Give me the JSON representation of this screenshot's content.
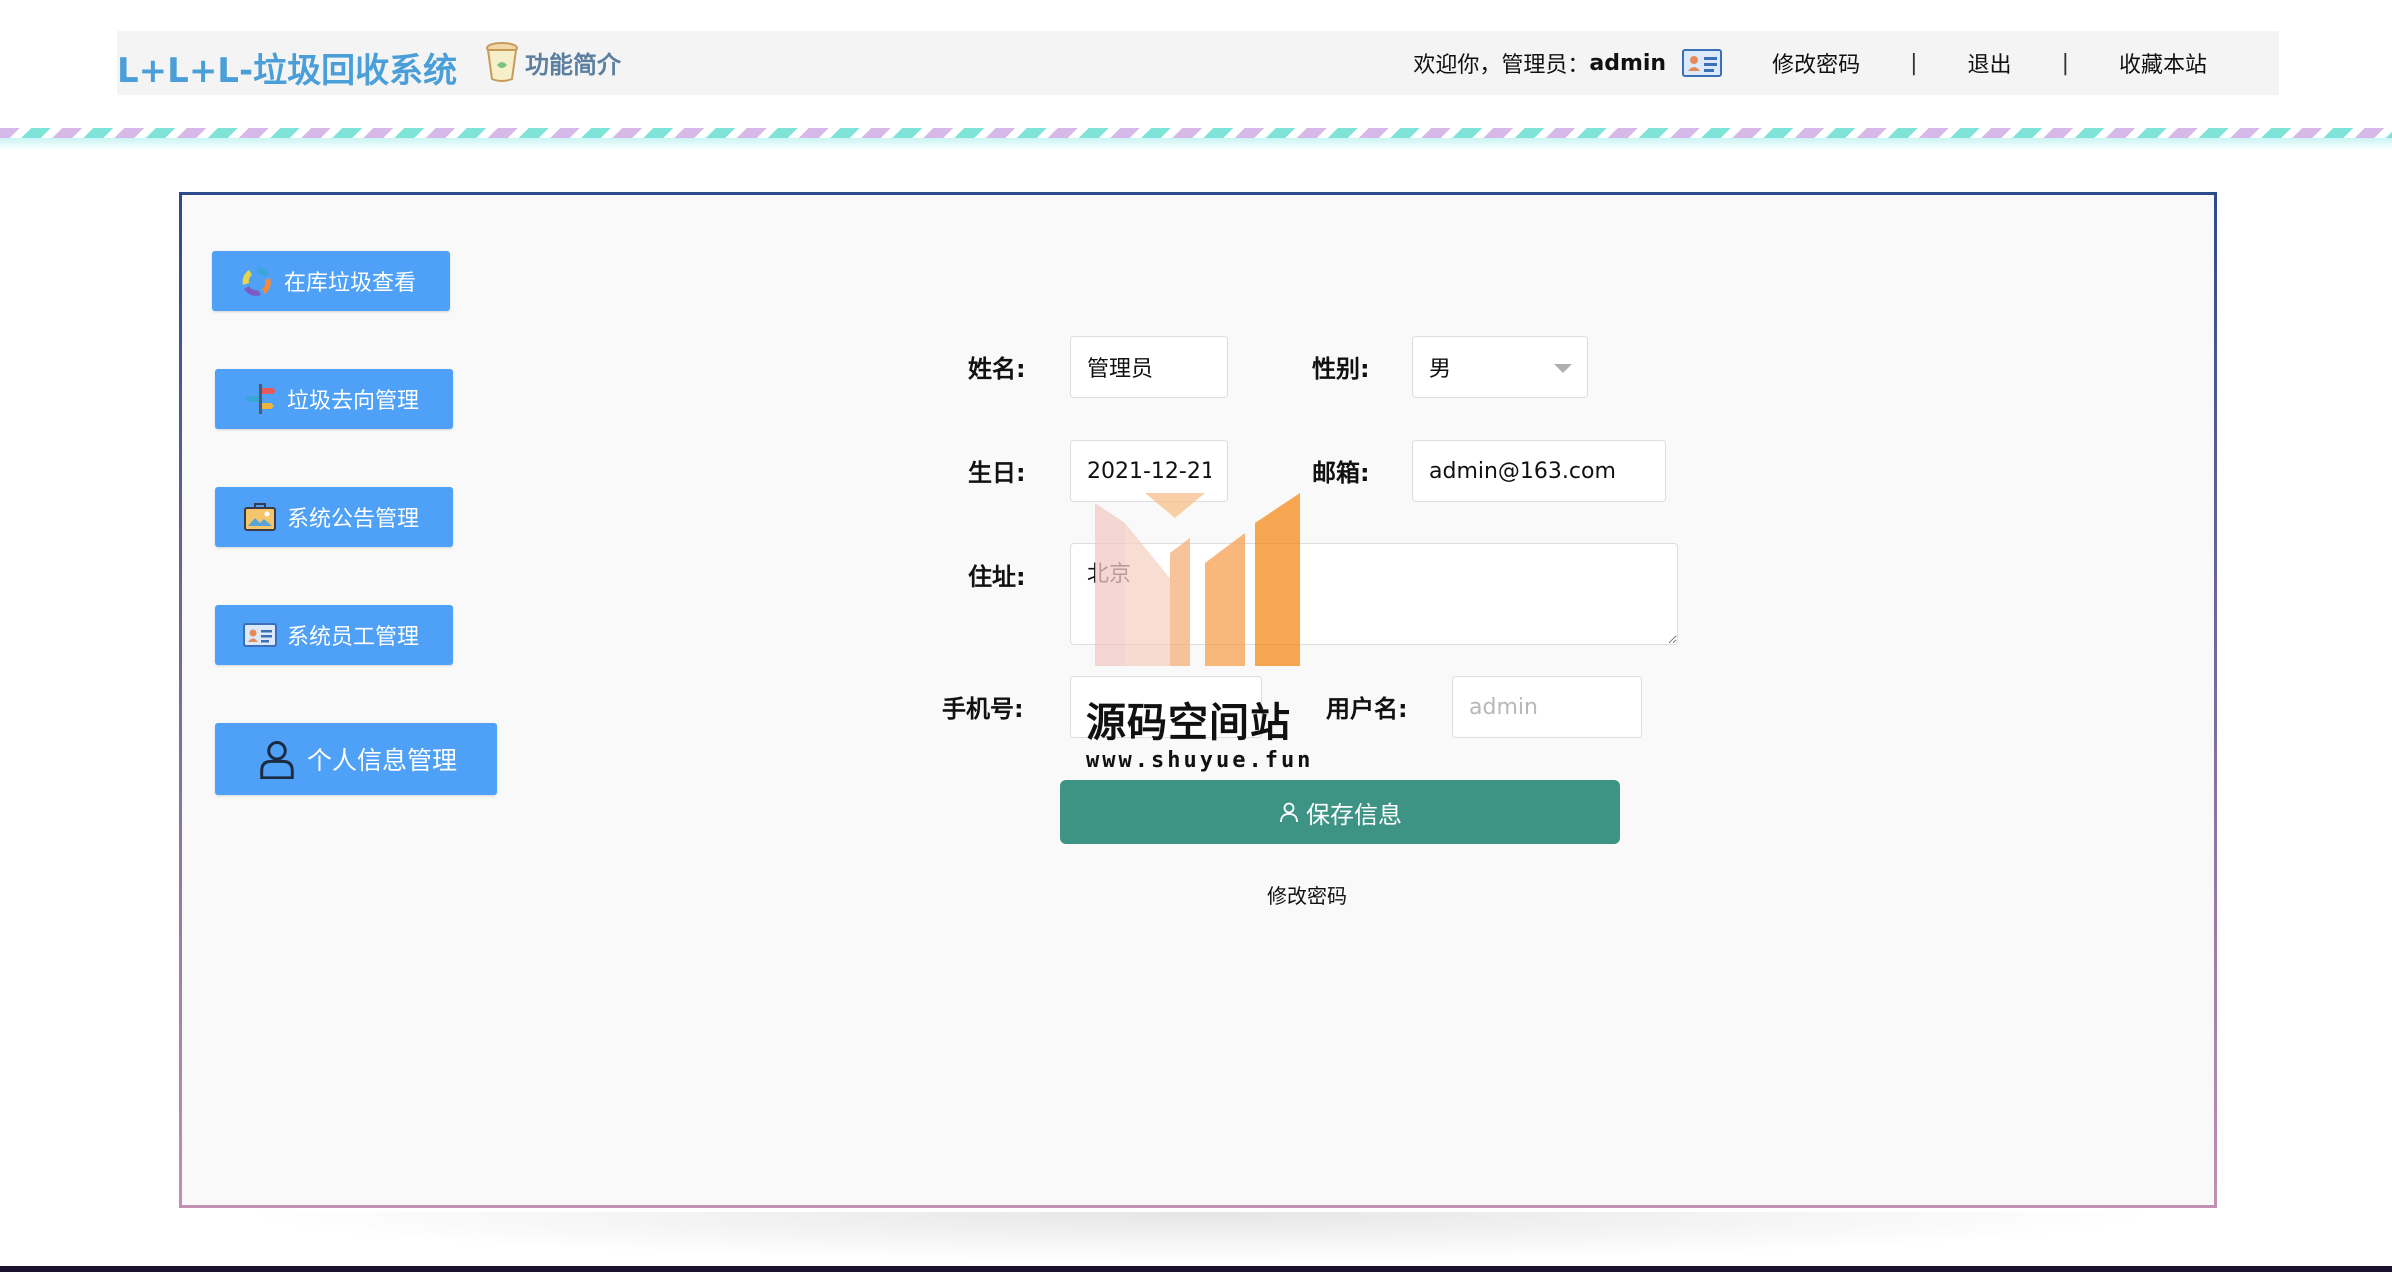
{
  "header": {
    "brand": "L+L+L-垃圾回收系统",
    "intro_label": "功能简介",
    "welcome_prefix": "欢迎你，管理员：",
    "welcome_user": "admin",
    "change_password": "修改密码",
    "separator": "|",
    "logout": "退出",
    "bookmark": "收藏本站"
  },
  "sidebar": {
    "items": [
      {
        "label": "在库垃圾查看",
        "icon": "recycle-icon"
      },
      {
        "label": "垃圾去向管理",
        "icon": "signpost-icon"
      },
      {
        "label": "系统公告管理",
        "icon": "announcement-icon"
      },
      {
        "label": "系统员工管理",
        "icon": "id-card-icon"
      },
      {
        "label": "个人信息管理",
        "icon": "user-icon"
      }
    ]
  },
  "form": {
    "name_label": "姓名:",
    "name_value": "管理员",
    "gender_label": "性别:",
    "gender_value": "男",
    "birthday_label": "生日:",
    "birthday_value": "2021-12-21",
    "email_label": "邮箱:",
    "email_value": "admin@163.com",
    "address_label": "住址:",
    "address_value": "北京",
    "phone_label": "手机号:",
    "phone_value": "",
    "username_label": "用户名:",
    "username_placeholder": "admin",
    "save_label": "保存信息",
    "change_password_link": "修改密码"
  },
  "watermark": {
    "title": "源码空间站",
    "url": "www.shuyue.fun"
  },
  "colors": {
    "brand": "#4a9fd8",
    "sidebar_button": "#4fa0f7",
    "save_button": "#3d9384",
    "panel_border_top": "#2f4a8a",
    "panel_border_bottom": "#c190b2"
  }
}
